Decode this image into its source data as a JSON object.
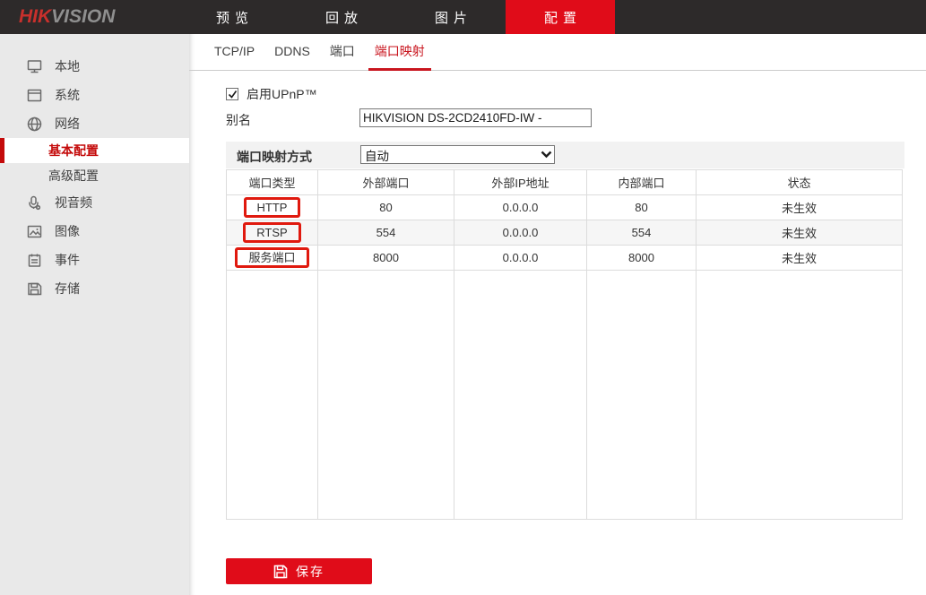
{
  "brand": {
    "logo_hik": "HIK",
    "logo_vision": "VISION"
  },
  "top_nav": {
    "items": [
      {
        "label": "预览",
        "active": false
      },
      {
        "label": "回放",
        "active": false
      },
      {
        "label": "图片",
        "active": false
      },
      {
        "label": "配置",
        "active": true
      }
    ]
  },
  "sidebar": {
    "items": [
      {
        "label": "本地",
        "icon": "monitor-icon"
      },
      {
        "label": "系统",
        "icon": "window-icon"
      },
      {
        "label": "网络",
        "icon": "globe-icon",
        "expanded": true,
        "children": [
          {
            "label": "基本配置",
            "active": true
          },
          {
            "label": "高级配置",
            "active": false
          }
        ]
      },
      {
        "label": "视音频",
        "icon": "microphone-icon"
      },
      {
        "label": "图像",
        "icon": "image-icon"
      },
      {
        "label": "事件",
        "icon": "event-icon"
      },
      {
        "label": "存储",
        "icon": "storage-icon"
      }
    ]
  },
  "tabs": [
    {
      "label": "TCP/IP",
      "active": false
    },
    {
      "label": "DDNS",
      "active": false
    },
    {
      "label": "端口",
      "active": false
    },
    {
      "label": "端口映射",
      "active": true
    }
  ],
  "form": {
    "upnp_checkbox_label": "启用UPnP™",
    "upnp_checked": true,
    "alias_label": "别名",
    "alias_value": "HIKVISION DS-2CD2410FD-IW -",
    "mapping_mode_label": "端口映射方式",
    "mapping_mode_value": "自动"
  },
  "table": {
    "headers": [
      "端口类型",
      "外部端口",
      "外部IP地址",
      "内部端口",
      "状态"
    ],
    "rows": [
      {
        "port_type": "HTTP",
        "external_port": "80",
        "external_ip": "0.0.0.0",
        "internal_port": "80",
        "status": "未生效",
        "annotated": true
      },
      {
        "port_type": "RTSP",
        "external_port": "554",
        "external_ip": "0.0.0.0",
        "internal_port": "554",
        "status": "未生效",
        "annotated": true
      },
      {
        "port_type": "服务端口",
        "external_port": "8000",
        "external_ip": "0.0.0.0",
        "internal_port": "8000",
        "status": "未生效",
        "annotated": true
      }
    ]
  },
  "save_button": {
    "label": "保存"
  },
  "colors": {
    "brand_red": "#e00c19",
    "tab_active_red": "#c9151e",
    "sidebar_active_red": "#c40a0a",
    "annotation_red": "#e0190e",
    "topbar_bg": "#2d2a2a",
    "sidebar_bg": "#e9e9e9",
    "band_bg": "#f2f2f2"
  }
}
